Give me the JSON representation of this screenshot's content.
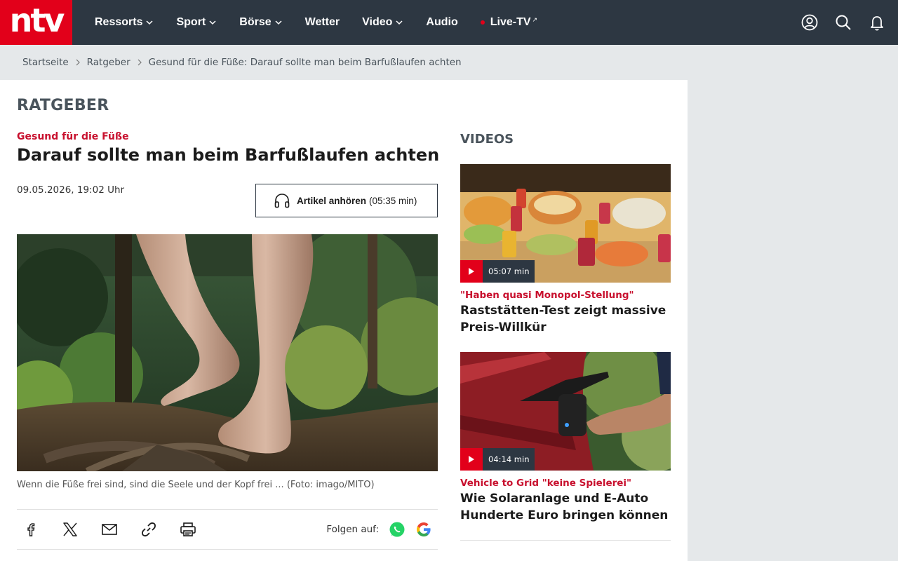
{
  "brand": {
    "logo_text": "ntv",
    "color": "#e2001a",
    "header_bg": "#2d3742"
  },
  "nav": {
    "items": [
      {
        "label": "Ressorts",
        "has_dropdown": true
      },
      {
        "label": "Sport",
        "has_dropdown": true
      },
      {
        "label": "Börse",
        "has_dropdown": true
      },
      {
        "label": "Wetter",
        "has_dropdown": false
      },
      {
        "label": "Video",
        "has_dropdown": true
      },
      {
        "label": "Audio",
        "has_dropdown": false
      }
    ],
    "live": {
      "label": "Live-TV",
      "ext": "↗"
    },
    "icons": [
      "user-icon",
      "search-icon",
      "bell-icon"
    ]
  },
  "breadcrumb": {
    "items": [
      "Startseite",
      "Ratgeber",
      "Gesund für die Füße: Darauf sollte man beim Barfußlaufen achten"
    ]
  },
  "section": {
    "title": "RATGEBER"
  },
  "article": {
    "kicker": "Gesund für die Füße",
    "headline": "Darauf sollte man beim Barfußlaufen achten",
    "date": "09.05.2026, 19:02 Uhr",
    "listen": {
      "label": "Artikel anhören",
      "duration": "(05:35 min)"
    },
    "caption": "Wenn die Füße frei sind, sind die Seele und der Kopf frei ... (Foto: imago/MITO)"
  },
  "share": {
    "icons": [
      "facebook-icon",
      "x-icon",
      "mail-icon",
      "link-icon",
      "print-icon"
    ],
    "follow_label": "Folgen auf:",
    "follow_icons": [
      "whatsapp-icon",
      "google-icon"
    ]
  },
  "videos": {
    "title": "VIDEOS",
    "items": [
      {
        "duration": "05:07 min",
        "kicker": "\"Haben quasi Monopol-Stellung\"",
        "headline": "Raststätten-Test zeigt massive Preis-Willkür"
      },
      {
        "duration": "04:14 min",
        "kicker": "Vehicle to Grid \"keine Spielerei\"",
        "headline": "Wie Solaranlage und E-Auto Hunderte Euro bringen können"
      }
    ]
  }
}
